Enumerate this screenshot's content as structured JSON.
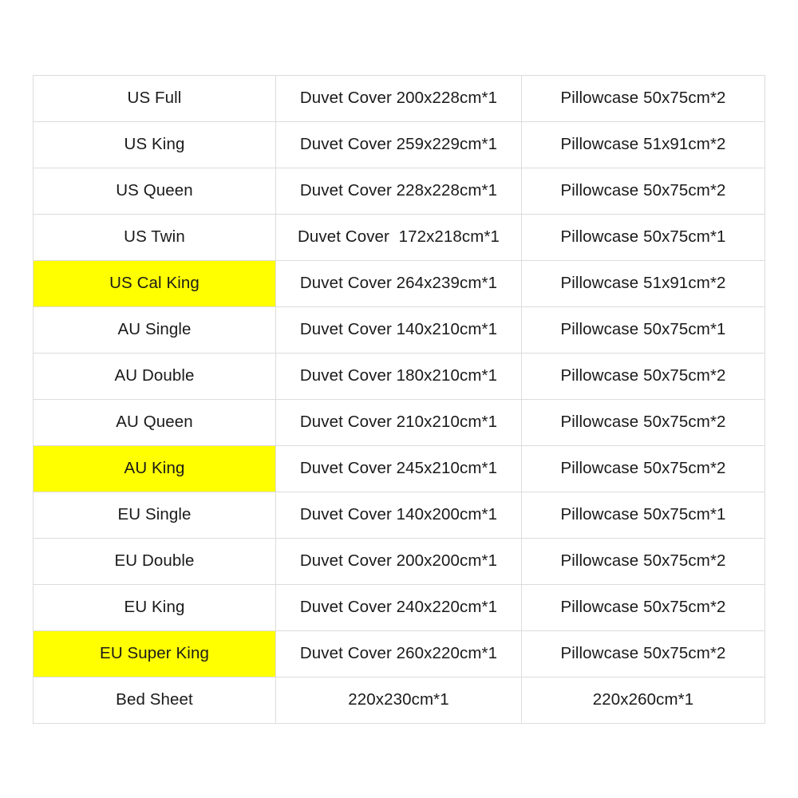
{
  "table": {
    "name": "bedding-size-chart",
    "highlight_color": "#ffff00",
    "border_color": "#dcdcdc",
    "text_color": "#1a1a1a",
    "rows": [
      {
        "size": "US Full",
        "duvet": "Duvet Cover 200x228cm*1",
        "pillowcase": "Pillowcase 50x75cm*2",
        "highlighted": false
      },
      {
        "size": "US King",
        "duvet": "Duvet Cover 259x229cm*1",
        "pillowcase": "Pillowcase 51x91cm*2",
        "highlighted": false
      },
      {
        "size": "US Queen",
        "duvet": "Duvet Cover 228x228cm*1",
        "pillowcase": "Pillowcase 50x75cm*2",
        "highlighted": false
      },
      {
        "size": "US Twin",
        "duvet": "Duvet Cover  172x218cm*1",
        "pillowcase": "Pillowcase 50x75cm*1",
        "highlighted": false
      },
      {
        "size": "US Cal King",
        "duvet": "Duvet Cover 264x239cm*1",
        "pillowcase": "Pillowcase 51x91cm*2",
        "highlighted": true
      },
      {
        "size": "AU Single",
        "duvet": "Duvet Cover 140x210cm*1",
        "pillowcase": "Pillowcase 50x75cm*1",
        "highlighted": false
      },
      {
        "size": "AU Double",
        "duvet": "Duvet Cover 180x210cm*1",
        "pillowcase": "Pillowcase 50x75cm*2",
        "highlighted": false
      },
      {
        "size": "AU Queen",
        "duvet": "Duvet Cover 210x210cm*1",
        "pillowcase": "Pillowcase 50x75cm*2",
        "highlighted": false
      },
      {
        "size": "AU King",
        "duvet": "Duvet Cover 245x210cm*1",
        "pillowcase": "Pillowcase 50x75cm*2",
        "highlighted": true
      },
      {
        "size": "EU Single",
        "duvet": "Duvet Cover 140x200cm*1",
        "pillowcase": "Pillowcase 50x75cm*1",
        "highlighted": false
      },
      {
        "size": "EU Double",
        "duvet": "Duvet Cover 200x200cm*1",
        "pillowcase": "Pillowcase 50x75cm*2",
        "highlighted": false
      },
      {
        "size": "EU King",
        "duvet": "Duvet Cover 240x220cm*1",
        "pillowcase": "Pillowcase 50x75cm*2",
        "highlighted": false
      },
      {
        "size": "EU Super King",
        "duvet": "Duvet Cover 260x220cm*1",
        "pillowcase": "Pillowcase 50x75cm*2",
        "highlighted": true
      },
      {
        "size": "Bed Sheet",
        "duvet": "220x230cm*1",
        "pillowcase": "220x260cm*1",
        "highlighted": false
      }
    ]
  }
}
